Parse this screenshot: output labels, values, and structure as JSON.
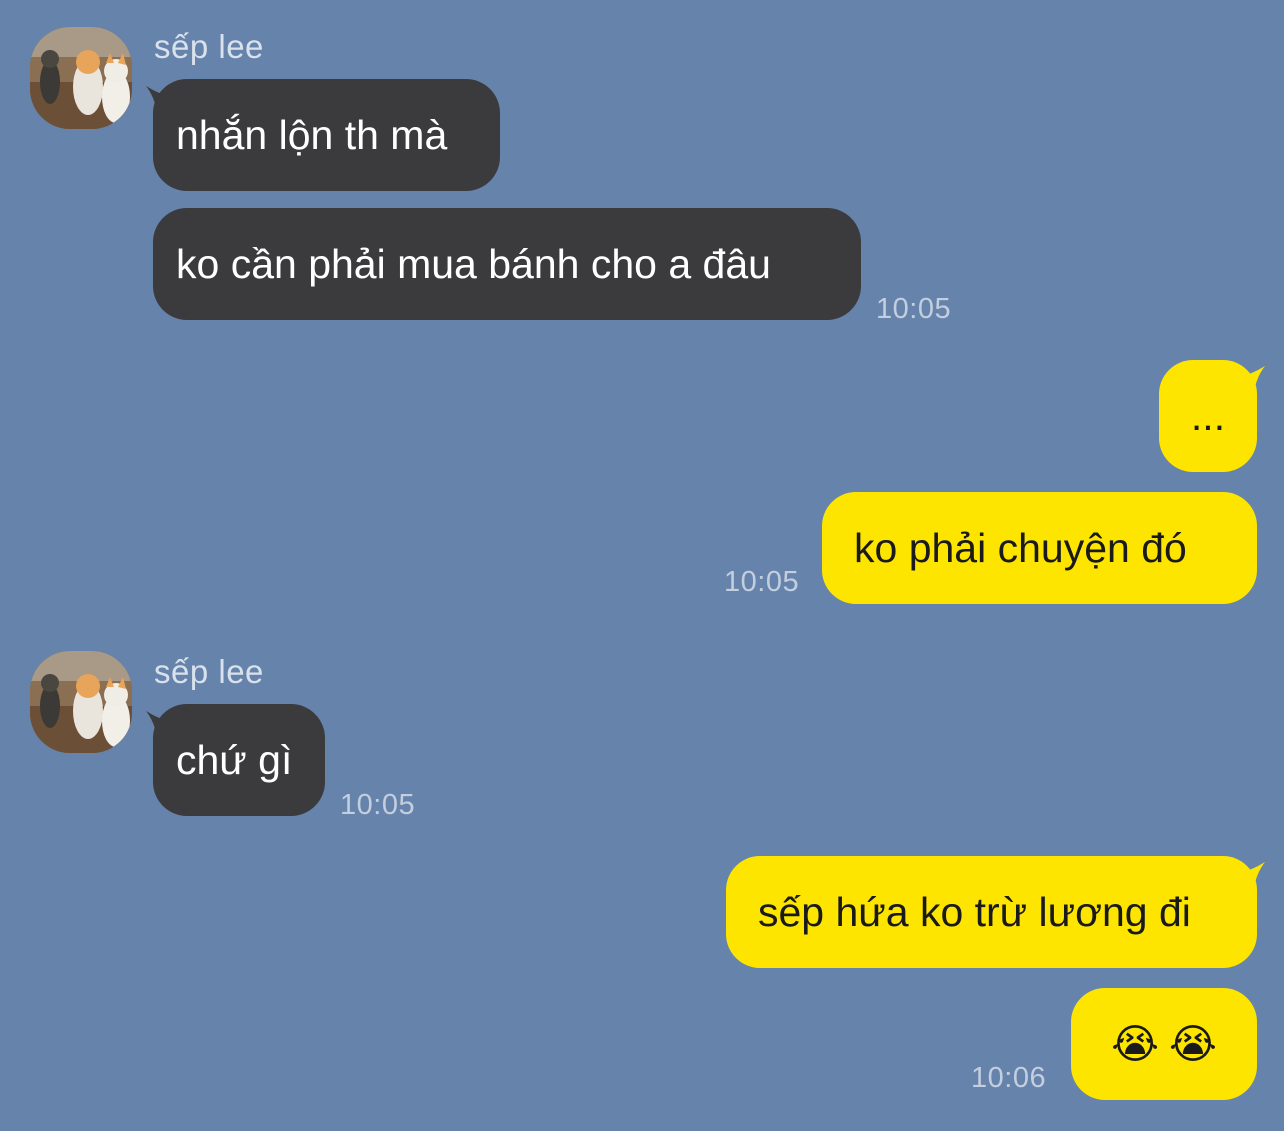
{
  "chat": {
    "messages": [
      {
        "sender": "sếp lee",
        "text": "nhắn lộn th mà"
      },
      {
        "text": "ko cần phải mua bánh cho a đâu",
        "time": "10:05"
      },
      {
        "text": "..."
      },
      {
        "text": "ko phải chuyện đó",
        "time": "10:05"
      },
      {
        "sender": "sếp lee",
        "text": "chứ gì",
        "time": "10:05"
      },
      {
        "text": "sếp hứa ko trừ lương đi"
      },
      {
        "emoji": [
          "😭",
          "😭"
        ],
        "emoji_names": [
          "loudly-crying-face-icon",
          "loudly-crying-face-icon"
        ],
        "time": "10:06"
      }
    ]
  },
  "colors": {
    "background": "#6683AB",
    "incoming_bubble": "#3B3B3D",
    "outgoing_bubble": "#FEE500"
  }
}
